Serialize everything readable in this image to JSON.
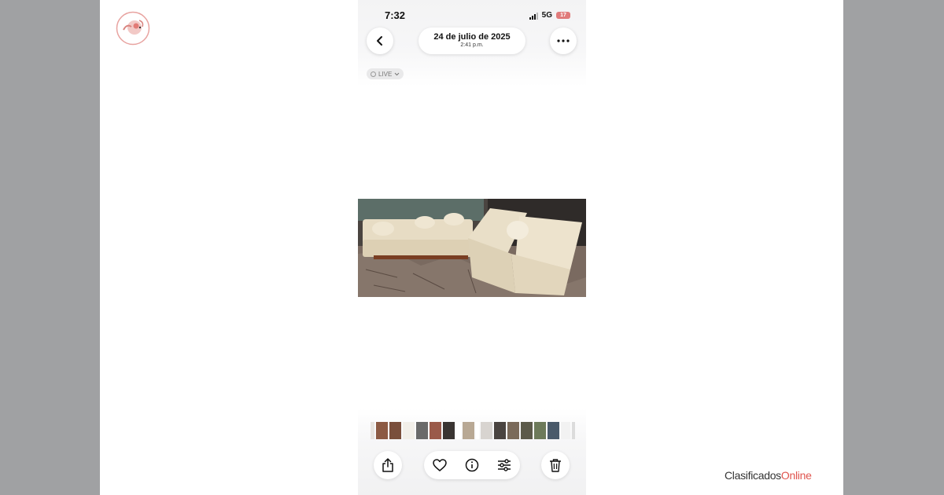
{
  "status_bar": {
    "time": "7:32",
    "network": "5G",
    "battery": "17"
  },
  "header": {
    "date": "24 de julio de 2025",
    "time": "2:41 p.m."
  },
  "live_badge": {
    "label": "LIVE"
  },
  "brand": {
    "name": "Clasificados",
    "accent": "Online",
    "accent_color": "#e0554f"
  },
  "icons": {
    "back": "chevron-left-icon",
    "more": "ellipsis-icon",
    "share": "share-icon",
    "favorite": "heart-icon",
    "info": "info-icon",
    "adjust": "sliders-icon",
    "delete": "trash-icon"
  }
}
